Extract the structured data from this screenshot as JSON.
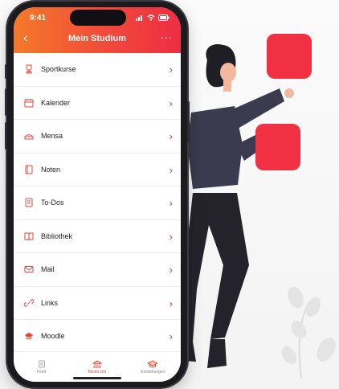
{
  "status": {
    "time": "9:41"
  },
  "header": {
    "title": "Mein Studium",
    "back_icon": "chevron-left-icon",
    "more_icon": "more-icon"
  },
  "menu": {
    "items": [
      {
        "label": "Sportkurse",
        "icon": "trophy-icon"
      },
      {
        "label": "Kalender",
        "icon": "calendar-icon"
      },
      {
        "label": "Mensa",
        "icon": "tray-icon"
      },
      {
        "label": "Noten",
        "icon": "notebook-icon"
      },
      {
        "label": "To-Dos",
        "icon": "checklist-icon"
      },
      {
        "label": "Bibliothek",
        "icon": "book-icon"
      },
      {
        "label": "Mail",
        "icon": "mail-icon"
      },
      {
        "label": "Links",
        "icon": "link-icon"
      },
      {
        "label": "Moodle",
        "icon": "graduation-cap-icon"
      }
    ]
  },
  "tabbar": {
    "tabs": [
      {
        "label": "Feed",
        "icon": "feed-icon",
        "active": false
      },
      {
        "label": "Meine Uni",
        "icon": "university-icon",
        "active": true
      },
      {
        "label": "Einstellungen",
        "icon": "graduation-cap-icon",
        "active": false
      }
    ]
  },
  "colors": {
    "accent": "#e8453a",
    "gradient_start": "#f47a2a",
    "gradient_end": "#ee2d44",
    "square": "#f23044"
  }
}
